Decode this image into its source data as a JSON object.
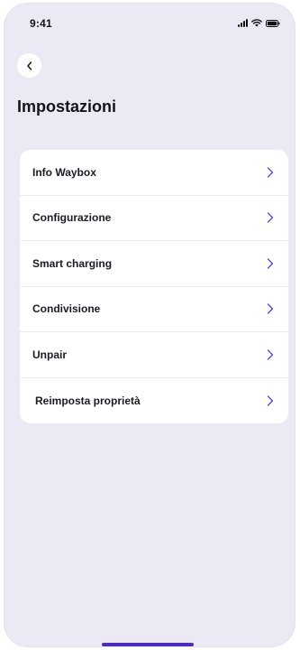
{
  "status_bar": {
    "time": "9:41"
  },
  "header": {
    "title": "Impostazioni"
  },
  "settings": {
    "items": [
      {
        "label": "Info Waybox",
        "icon": "chevron-right-icon"
      },
      {
        "label": "Configurazione",
        "icon": "chevron-right-icon"
      },
      {
        "label": "Smart charging",
        "icon": "chevron-right-icon"
      },
      {
        "label": "Condivisione",
        "icon": "chevron-right-icon"
      },
      {
        "label": "Unpair",
        "icon": "chevron-right-icon"
      },
      {
        "label": "Reimposta proprietà",
        "icon": "chevron-right-icon"
      }
    ]
  },
  "colors": {
    "background": "#ebe9f3",
    "card": "#ffffff",
    "accent": "#5b3fd8",
    "home_indicator": "#4f2ab8",
    "text": "#1d1a26"
  }
}
